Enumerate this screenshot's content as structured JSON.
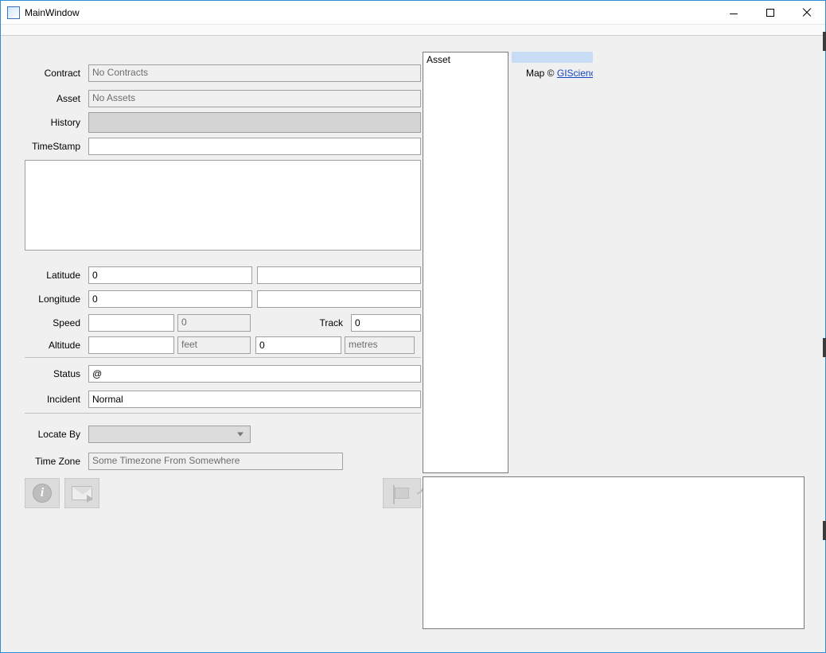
{
  "window": {
    "title": "MainWindow"
  },
  "labels": {
    "contract": "Contract",
    "asset": "Asset",
    "history": "History",
    "timestamp": "TimeStamp",
    "latitude": "Latitude",
    "longitude": "Longitude",
    "speed": "Speed",
    "track": "Track",
    "altitude": "Altitude",
    "status": "Status",
    "incident": "Incident",
    "locate_by": "Locate By",
    "time_zone": "Time Zone"
  },
  "values": {
    "contract": "No Contracts",
    "asset": "No Assets",
    "timestamp": "",
    "latitude_a": "0",
    "latitude_b": "",
    "longitude_a": "0",
    "longitude_b": "",
    "speed_a": "",
    "speed_b": "0",
    "track": "0",
    "altitude_a": "",
    "altitude_unit": "feet",
    "altitude_b": "0",
    "altitude_unit2": "metres",
    "status": "@",
    "incident": "Normal",
    "locate_by": "",
    "time_zone": "Some Timezone From Somewhere"
  },
  "sidebar": {
    "asset_list_header": "Asset"
  },
  "map": {
    "credit_prefix": "Map © ",
    "credit_link": "GIScience Re"
  }
}
